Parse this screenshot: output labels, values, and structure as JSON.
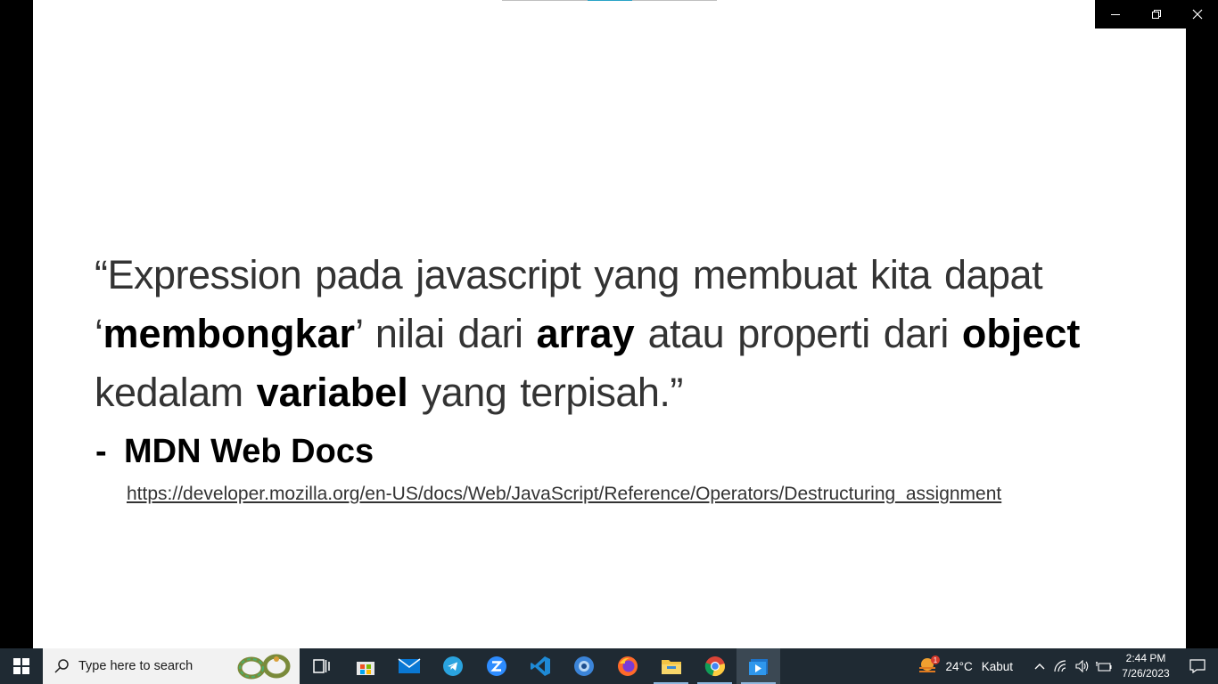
{
  "slide": {
    "quote": {
      "line1": "“Expression pada javascript yang membuat kita dapat",
      "l2_open": "‘",
      "l2_b1": "membongkar",
      "l2_t1": "’ nilai dari ",
      "l2_b2": "array",
      "l2_t2": " atau properti dari ",
      "l2_b3": "object",
      "l3_t1": "kedalam ",
      "l3_b1": "variabel",
      "l3_t2": " yang terpisah.”"
    },
    "attribution_dash": "-",
    "attribution": "MDN Web Docs",
    "link": "https://developer.mozilla.org/en-US/docs/Web/JavaScript/Reference/Operators/Destructuring_assignment"
  },
  "taskbar": {
    "search_placeholder": "Type here to search",
    "weather_temp": "24°C",
    "weather_desc": "Kabut",
    "weather_badge": "1",
    "time": "2:44 PM",
    "date": "7/26/2023"
  }
}
